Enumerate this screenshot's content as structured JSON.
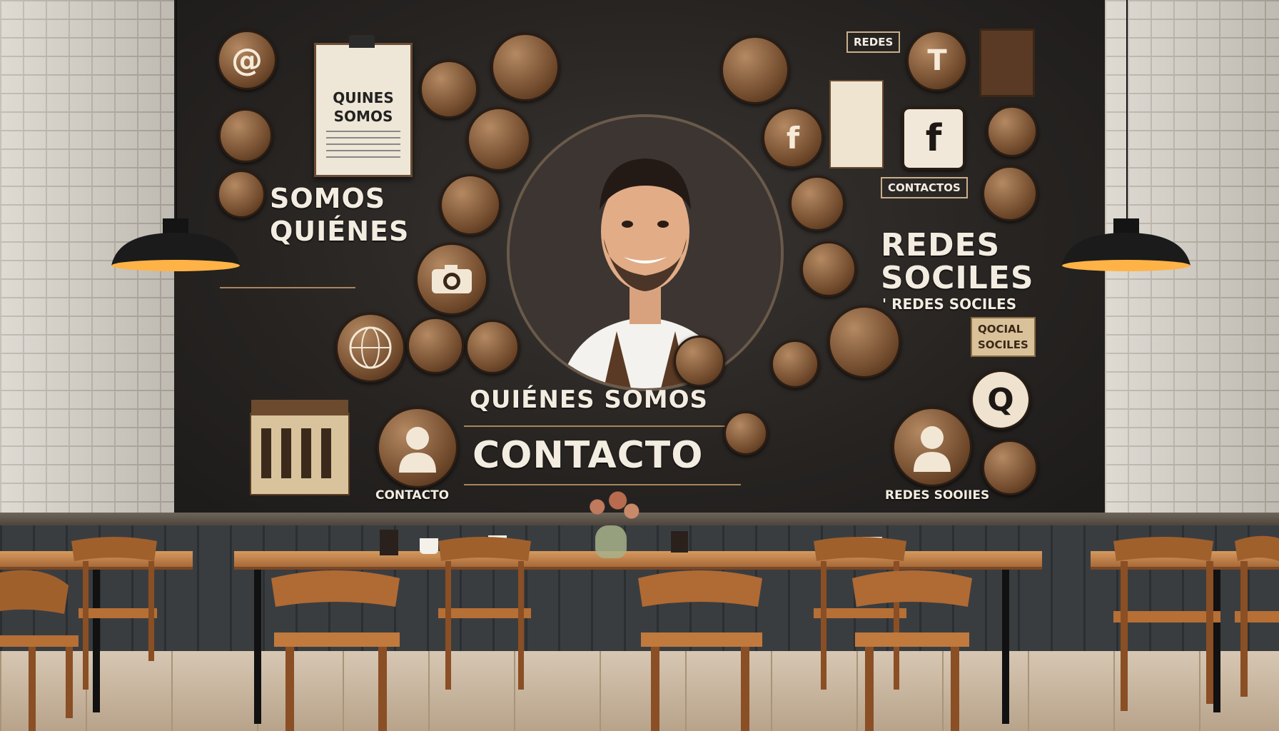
{
  "wall": {
    "paper_line1": "QUINES",
    "paper_line2": "SOMOS",
    "left_title_line1": "SOMOS",
    "left_title_line2": "QUIÉNES",
    "center_title": "QUIÉNES SOMOS",
    "center_contact": "CONTACTO",
    "left_bottom_label": "CONTACTO",
    "top_right_label": "REDES",
    "contact_tag": "CONTACTOS",
    "right_title_line1": "REDES",
    "right_title_line2": "SOCILES",
    "right_subtitle": "' REDES SOCILES",
    "social_tag_line1": "QOCIAL",
    "social_tag_line2": "SOCILES",
    "right_bottom_label": "REDES SOOIIES"
  },
  "icons": {
    "at": "@",
    "facebook": "f",
    "search": "Q",
    "phone": "T"
  },
  "colors": {
    "panel": "#262321",
    "bronze": "#8a5a35",
    "cream": "#f3ece0",
    "wood": "#c9884d"
  }
}
